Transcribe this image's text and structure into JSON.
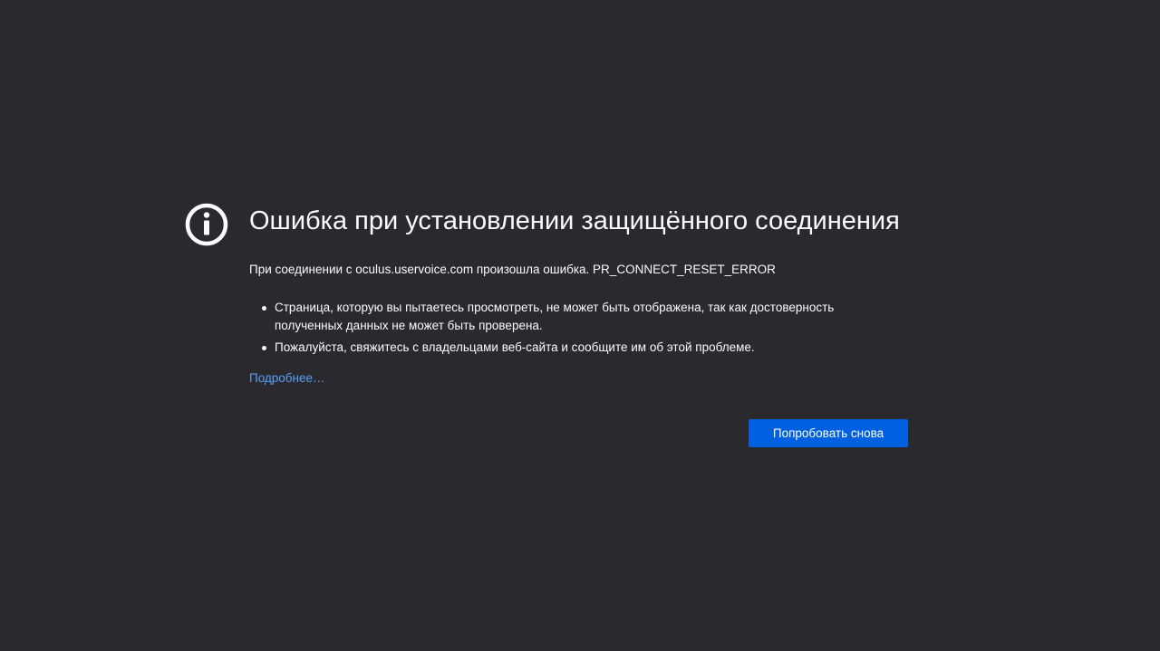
{
  "error": {
    "title": "Ошибка при установлении защищённого соединения",
    "short_description": "При соединении с oculus.uservoice.com произошла ошибка. PR_CONNECT_RESET_ERROR",
    "details": [
      "Страница, которую вы пытаетесь просмотреть, не может быть отображена, так как достоверность полученных данных не может быть проверена.",
      "Пожалуйста, свяжитесь с владельцами веб-сайта и сообщите им об этой проблеме."
    ],
    "learn_more": "Подробнее…",
    "try_again_label": "Попробовать снова"
  },
  "icon": "info-icon",
  "colors": {
    "background": "#2a2a2e",
    "text": "#fbfbfe",
    "link": "#57a0f5",
    "button": "#0061e0"
  }
}
